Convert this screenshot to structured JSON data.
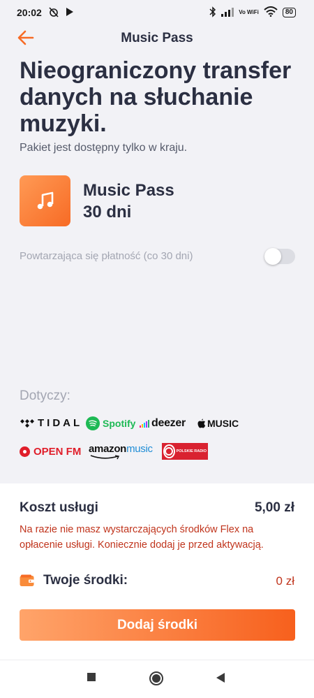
{
  "status_bar": {
    "time": "20:02",
    "network_label": "Vo WiFi",
    "battery": "80"
  },
  "header": {
    "title": "Music Pass"
  },
  "hero": {
    "headline": "Nieograniczony transfer danych na słuchanie muzyki.",
    "subtitle": "Pakiet jest dostępny tylko w kraju."
  },
  "package": {
    "name": "Music Pass",
    "duration": "30 dni",
    "icon": "music-note-icon"
  },
  "recurring": {
    "label": "Powtarzająca się płatność (co 30 dni)",
    "enabled": false
  },
  "applies": {
    "label": "Dotyczy:",
    "services": {
      "tidal": "TIDAL",
      "spotify": "Spotify",
      "deezer": "deezer",
      "apple_music": "MUSIC",
      "open_fm": "OPEN FM",
      "amazon_bold": "amazon",
      "amazon_rest": "music",
      "polskie_radio": "POLSKIE RADIO"
    }
  },
  "summary": {
    "cost_label": "Koszt usługi",
    "cost_value": "5,00 zł",
    "warning": "Na razie nie masz wystarczających środków Flex na opłacenie usługi. Koniecznie dodaj je przed aktywacją.",
    "funds_label": "Twoje środki:",
    "funds_value": "0 zł",
    "cta_label": "Dodaj środki"
  },
  "colors": {
    "accent": "#f76b25",
    "warning": "#c0341c",
    "text": "#2b2f42",
    "muted": "#a3a6b2"
  }
}
